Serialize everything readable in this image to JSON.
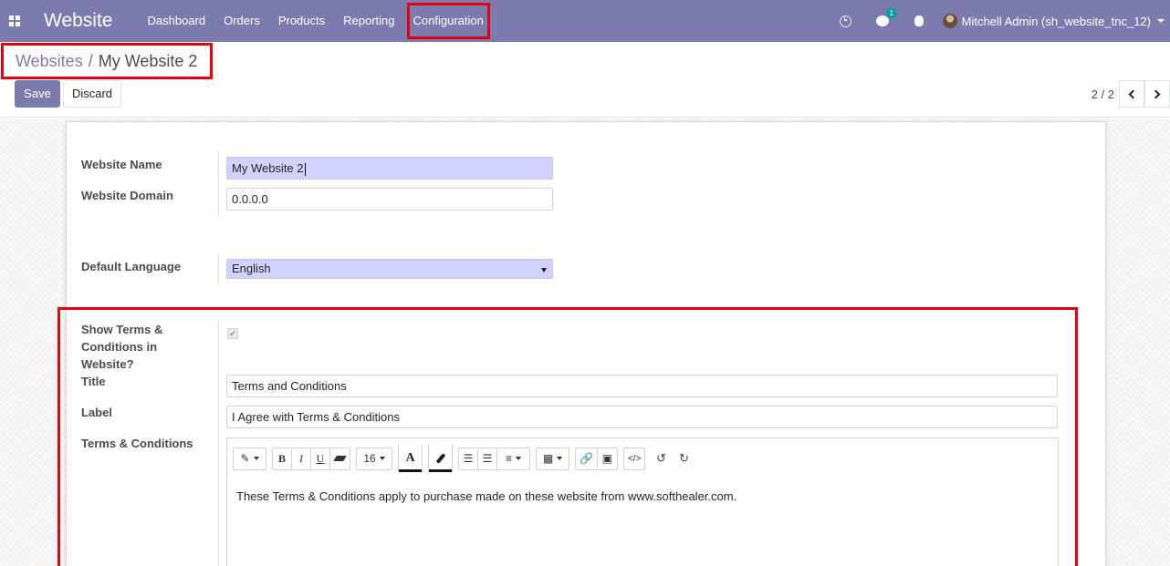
{
  "nav": {
    "brand": "Website",
    "menu": [
      "Dashboard",
      "Orders",
      "Products",
      "Reporting",
      "Configuration"
    ],
    "chat_count": "1",
    "user": "Mitchell Admin (sh_website_tnc_12)"
  },
  "breadcrumb": {
    "parent": "Websites",
    "separator": "/",
    "current": "My Website 2"
  },
  "actions": {
    "save": "Save",
    "discard": "Discard"
  },
  "pager": {
    "text": "2 / 2"
  },
  "form": {
    "website_name_label": "Website Name",
    "website_name_value": "My Website 2",
    "website_domain_label": "Website Domain",
    "website_domain_value": "0.0.0.0",
    "default_language_label": "Default Language",
    "default_language_value": "English",
    "show_tc_label": "Show Terms & Conditions in Website?",
    "show_tc_checked": true,
    "title_label": "Title",
    "title_value": "Terms and Conditions",
    "label_label": "Label",
    "label_value": "I Agree with Terms & Conditions",
    "tc_label": "Terms & Conditions",
    "tc_content": "These Terms & Conditions apply to purchase made on these website from www.softhealer.com."
  },
  "editor": {
    "font_size": "16",
    "bold": "B",
    "italic": "I",
    "underline": "U",
    "color_letter": "A"
  },
  "colors": {
    "primary": "#7c7bad",
    "highlight": "#e3000f",
    "required_field": "#d2d2ff",
    "badge": "#00a09d"
  }
}
